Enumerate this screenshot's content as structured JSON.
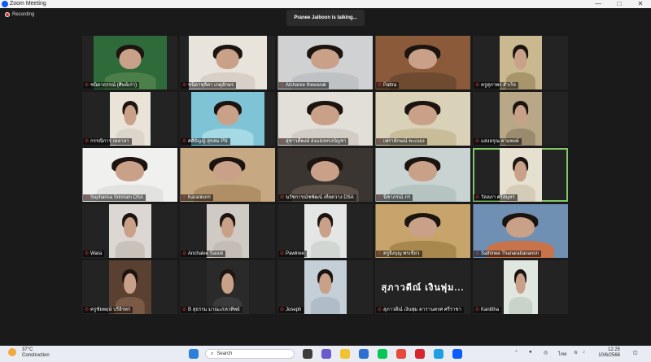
{
  "window": {
    "title": "Zoom Meeting",
    "minimize": "—",
    "maximize": "□",
    "close": "✕"
  },
  "recording": {
    "label": "Recording"
  },
  "talking": {
    "text": "Pranee Jaiboon is talking..."
  },
  "participants": [
    {
      "name": "ชนิดาธรรณ์ (ศิษย์เก่า)",
      "bg": "#2f6b3a",
      "cam": "#4d7f4a",
      "w": 90
    },
    {
      "name": "ชนิดาชุลิดา เกตุอักษร",
      "bg": "#e8e4dc",
      "cam": "#d7d0c6",
      "w": 96
    },
    {
      "name": "Atcharee thewarak",
      "bg": "#cfd1d2",
      "cam": "#bfc2c4",
      "w": 117
    },
    {
      "name": "Pattra",
      "bg": "#8a5a3a",
      "cam": "#6e4a30",
      "w": 117
    },
    {
      "name": "ครูสุภาพร สำเร็จ",
      "bg": "#c9b890",
      "cam": "#a8956c",
      "w": 52
    },
    {
      "name": "กรรณิการ เหลาลา",
      "bg": "#e9e3d8",
      "cam": "#dcd5ca",
      "w": 50
    },
    {
      "name": "ศศิธัญญ์ สุขสม PN",
      "bg": "#7fc4d6",
      "cam": "#a5d9e4",
      "w": 90
    },
    {
      "name": "สุชาวดีพงษ์ ส่งแสงทรงบัญชา",
      "bg": "#e2ded8",
      "cam": "#d2ccc4",
      "w": 117
    },
    {
      "name": "เพราลักษณ์ ทะเบอง",
      "bg": "#d9d1b8",
      "cam": "#c8bd98",
      "w": 117
    },
    {
      "name": "แสงอรุณ คามพงษ์",
      "bg": "#b8a888",
      "cam": "#9b8b6e",
      "w": 52
    },
    {
      "name": "Suphansa Sriniram DSA",
      "bg": "#f0f0ee",
      "cam": "#e2e2e0",
      "w": 117
    },
    {
      "name": "Karankorn",
      "bg": "#c6a882",
      "cam": "#b08f66",
      "w": 117
    },
    {
      "name": "นวัชการณ์ชพัฒน์ เทียดวาง DSA",
      "bg": "#3a3530",
      "cam": "#5a5048",
      "w": 117
    },
    {
      "name": "นิชาภรณ์ ภร",
      "bg": "#c9d4d2",
      "cam": "#b5c4c0",
      "w": 117
    },
    {
      "name": "วัลลภา ศรีสมุทร",
      "bg": "#e6e0d0",
      "cam": "#d5ccb8",
      "w": 52
    },
    {
      "name": "Wara",
      "bg": "#dcd7d2",
      "cam": "#c9c2bb",
      "w": 52
    },
    {
      "name": "Anchalee Sasuk",
      "bg": "#cfcac4",
      "cam": "#c3bdb5",
      "w": 52
    },
    {
      "name": "Pawinee",
      "bg": "#e3e6e4",
      "cam": "#d1d6d2",
      "w": 52
    },
    {
      "name": "ครูยิ่งบุญ พรเขียว",
      "bg": "#c7a46c",
      "cam": "#a9884e",
      "w": 117
    },
    {
      "name": "Sathinee Thanarattananon",
      "bg": "#6f8fb3",
      "cam": "#c9734a",
      "w": 117
    },
    {
      "name": "ครูชัยพฤษ์ บริอิรพร",
      "bg": "#5a4030",
      "cam": "#7a5a45",
      "w": 52
    },
    {
      "name": "B สุธรรม มาณะ/เหวทิพย์",
      "bg": "#2a2a2a",
      "cam": "#3a3a3a",
      "w": 52
    },
    {
      "name": "Joseph",
      "bg": "#c5cfd8",
      "cam": "#b0bcc8",
      "w": 52
    },
    {
      "name": "สุภาวดีณ์ เงินพุ่ม ดารานครศ ศรีราชา",
      "display": "สุภาวดีณ์ เงินพุ่ม...",
      "bg": "#232323",
      "cam": "#232323",
      "w": 0
    },
    {
      "name": "Kanittha",
      "bg": "#dfe7e0",
      "cam": "#c8d4ca",
      "w": 42
    }
  ],
  "taskbar": {
    "temp": "37°C",
    "condition": "Construction",
    "search_placeholder": "Search",
    "lang": "ไทย",
    "time": "12:25",
    "date": "10/6/2566"
  }
}
